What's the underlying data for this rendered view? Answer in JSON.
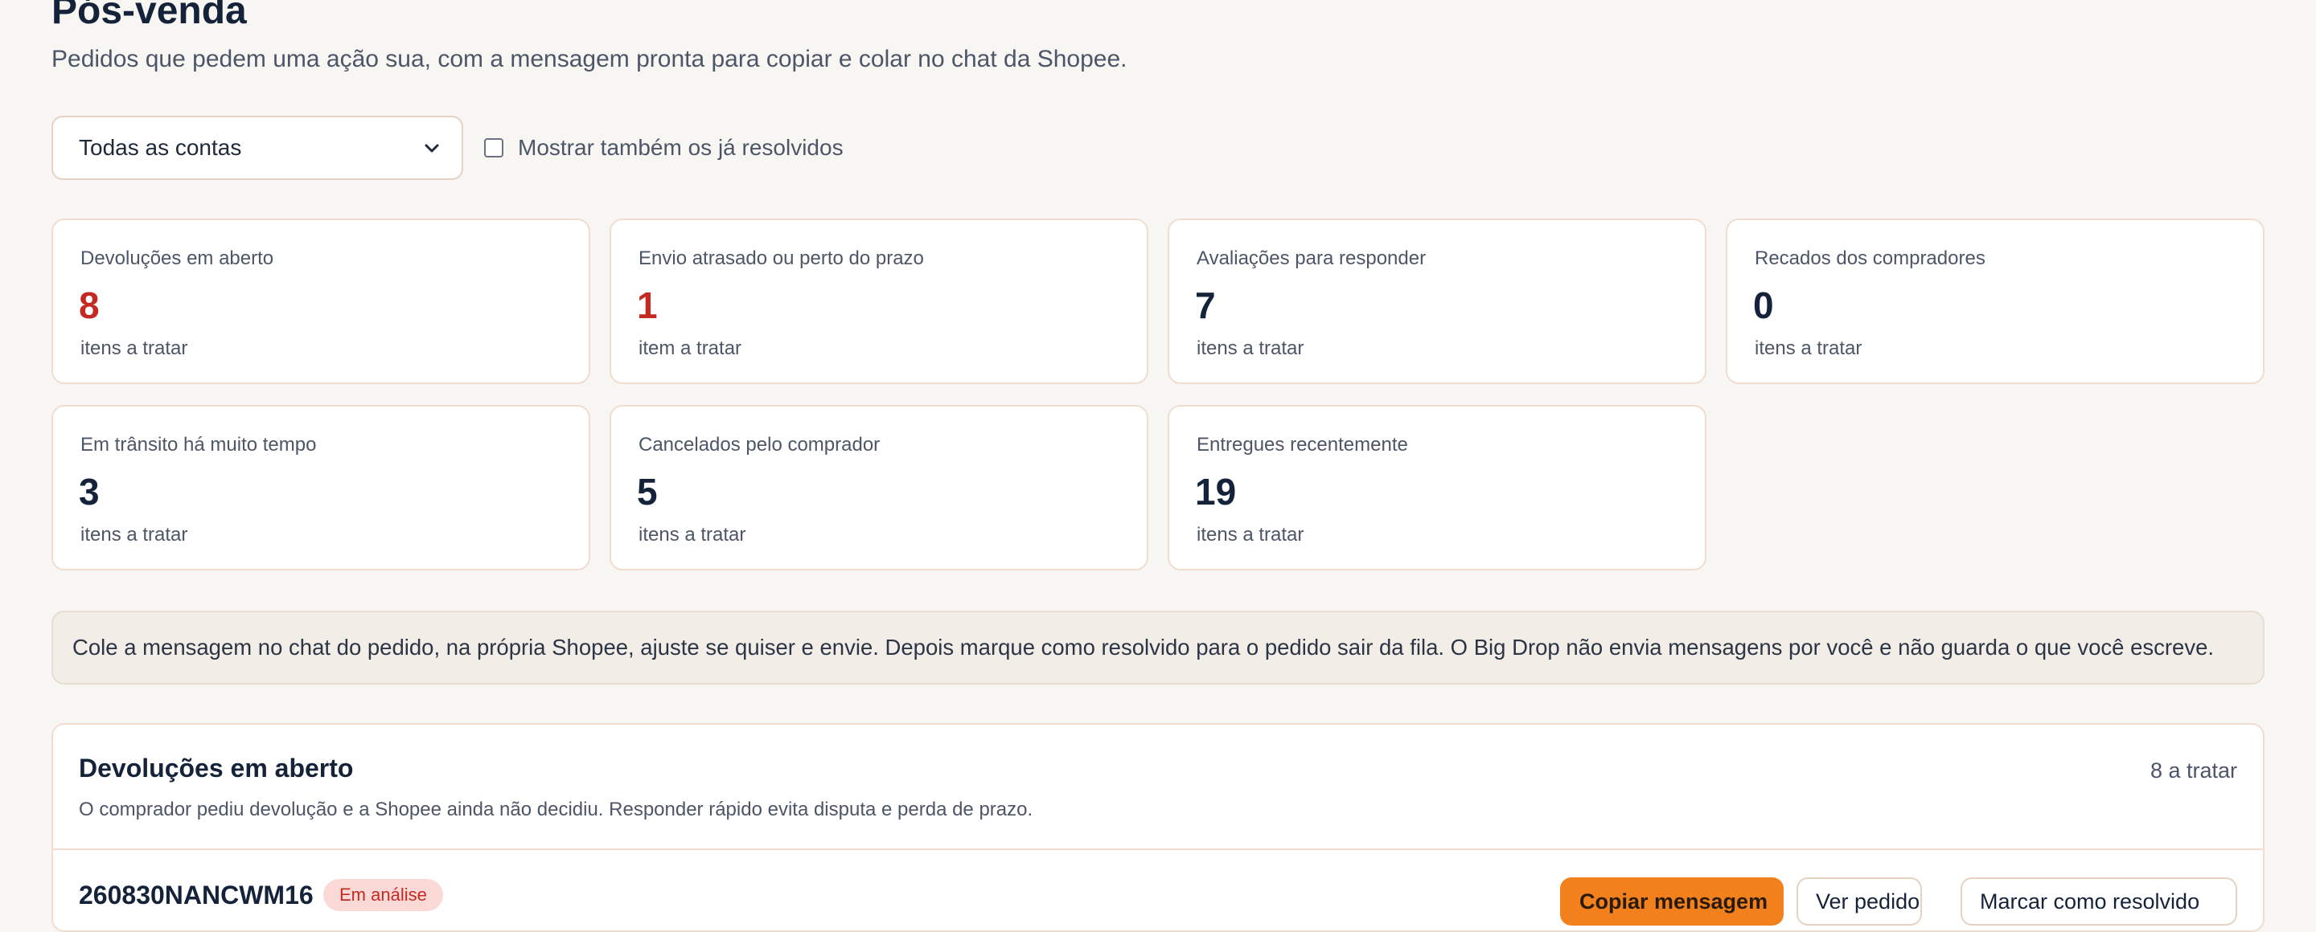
{
  "header": {
    "title": "Pós-venda",
    "subtitle": "Pedidos que pedem uma ação sua, com a mensagem pronta para copiar e colar no chat da Shopee."
  },
  "filters": {
    "account_select_value": "Todas as contas",
    "show_resolved_label": "Mostrar também os já resolvidos",
    "show_resolved_checked": false
  },
  "summary_cards": [
    {
      "title": "Devoluções em aberto",
      "count": "8",
      "unit": "itens a tratar",
      "alert": true
    },
    {
      "title": "Envio atrasado ou perto do prazo",
      "count": "1",
      "unit": "item a tratar",
      "alert": true
    },
    {
      "title": "Avaliações para responder",
      "count": "7",
      "unit": "itens a tratar",
      "alert": false
    },
    {
      "title": "Recados dos compradores",
      "count": "0",
      "unit": "itens a tratar",
      "alert": false
    },
    {
      "title": "Em trânsito há muito tempo",
      "count": "3",
      "unit": "itens a tratar",
      "alert": false
    },
    {
      "title": "Cancelados pelo comprador",
      "count": "5",
      "unit": "itens a tratar",
      "alert": false
    },
    {
      "title": "Entregues recentemente",
      "count": "19",
      "unit": "itens a tratar",
      "alert": false
    }
  ],
  "notice": "Cole a mensagem no chat do pedido, na própria Shopee, ajuste se quiser e envie. Depois marque como resolvido para o pedido sair da fila. O Big Drop não envia mensagens por você e não guarda o que você escreve.",
  "section": {
    "title": "Devoluções em aberto",
    "count_label": "8 a tratar",
    "description": "O comprador pediu devolução e a Shopee ainda não decidiu. Responder rápido evita disputa e perda de prazo.",
    "first_row": {
      "order_id": "260830NANCWM16",
      "status": "Em análise",
      "copy_button": "Copiar mensagem",
      "view_button": "Ver pedido",
      "resolve_button": "Marcar como resolvido"
    }
  },
  "colors": {
    "accent": "#f2801c",
    "alert": "#c52a22",
    "background": "#f8f6f2",
    "card_border": "#f0ddd0"
  }
}
